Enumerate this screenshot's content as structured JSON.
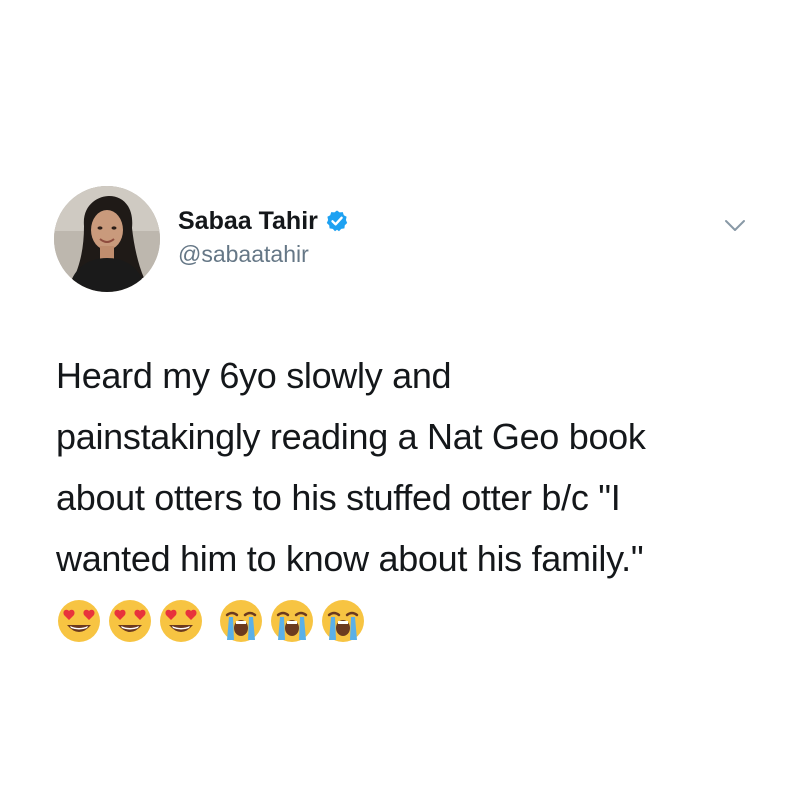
{
  "tweet": {
    "author": {
      "display_name": "Sabaa Tahir",
      "handle": "@sabaatahir",
      "verified": true,
      "avatar_icon": "profile-photo"
    },
    "text": "Heard my 6yo slowly and\npainstakingly reading a Nat Geo book\nabout otters to his stuffed otter b/c \"I\nwanted him to know about his family.\"",
    "emojis": [
      "heart-eyes-emoji",
      "heart-eyes-emoji",
      "heart-eyes-emoji",
      "loudly-crying-emoji",
      "loudly-crying-emoji",
      "loudly-crying-emoji"
    ],
    "menu_icon": "chevron-down-icon"
  },
  "colors": {
    "background": "#ffffff",
    "text": "#14171a",
    "handle": "#657786",
    "verified_badge": "#1da1f2"
  }
}
